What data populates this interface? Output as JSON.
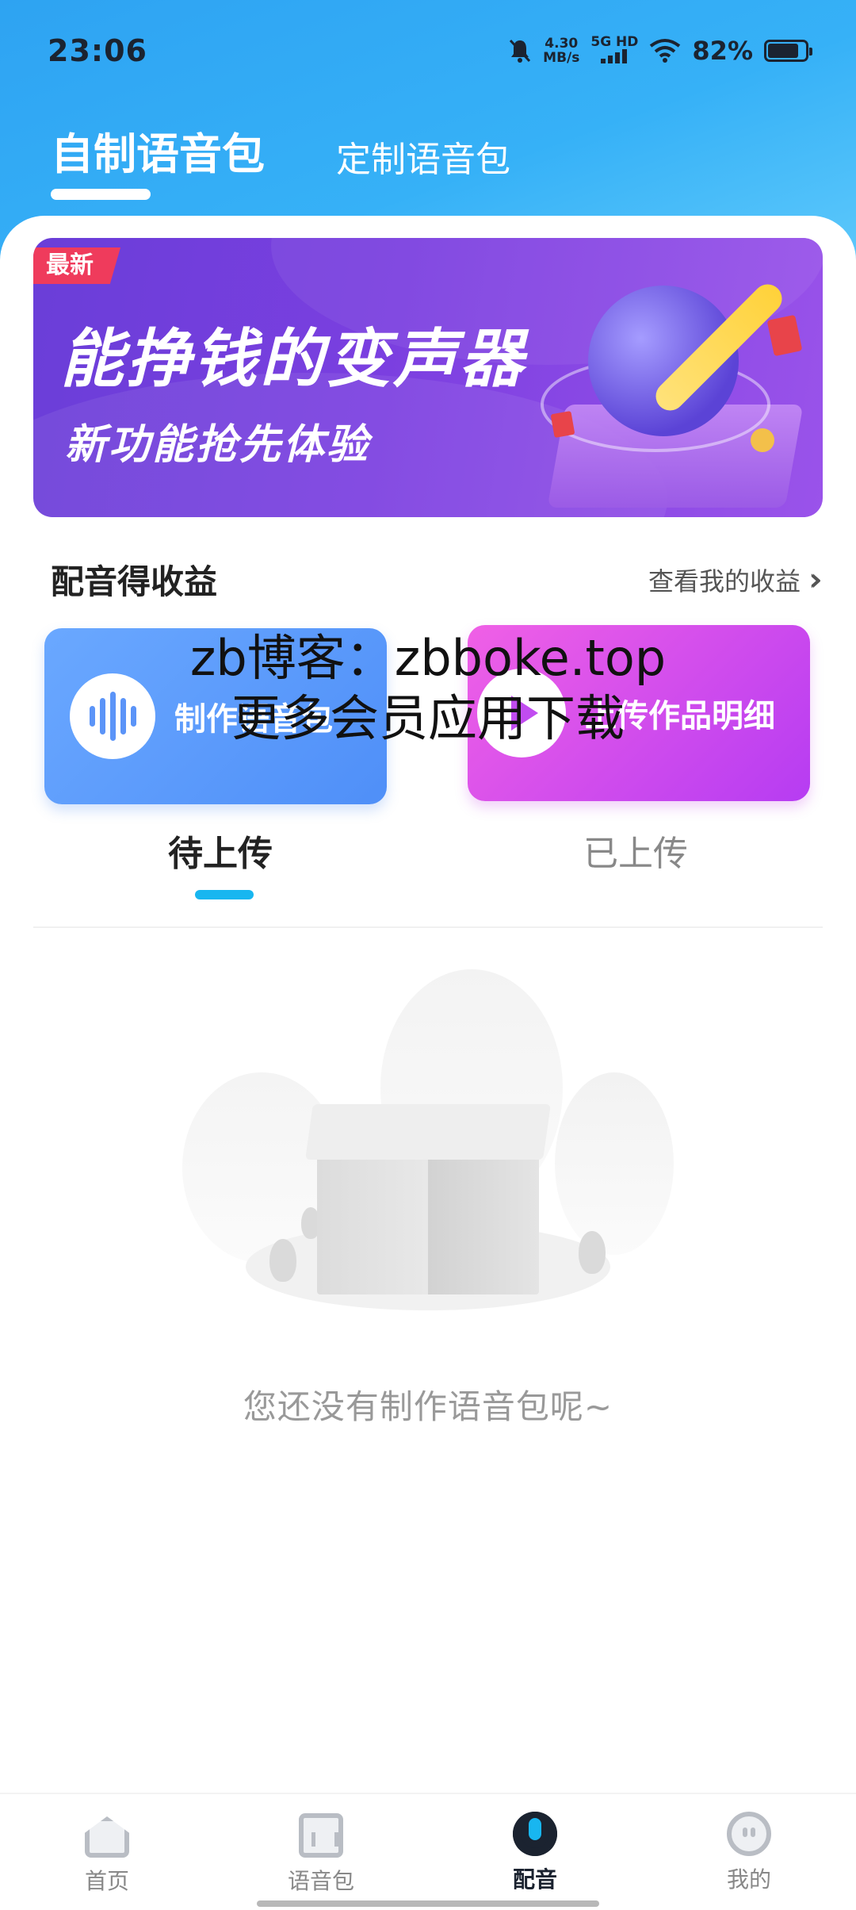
{
  "status": {
    "time": "23:06",
    "net_speed_value": "4.30",
    "net_speed_unit": "MB/s",
    "signal_label": "5G HD",
    "battery": "82%",
    "battery_level": 0.82
  },
  "top_tabs": [
    {
      "label": "自制语音包",
      "active": true
    },
    {
      "label": "定制语音包",
      "active": false
    }
  ],
  "banner": {
    "badge": "最新",
    "title": "能挣钱的变声器",
    "subtitle": "新功能抢先体验"
  },
  "section": {
    "title": "配音得收益",
    "link": "查看我的收益"
  },
  "feature_cards": [
    {
      "label": "制作语音包",
      "icon": "waveform-icon"
    },
    {
      "label": "上传作品明细",
      "icon": "play-icon"
    }
  ],
  "watermark": {
    "line1": "zb博客：zbboke.top",
    "line2": "更多会员应用下载"
  },
  "sub_tabs": [
    {
      "label": "待上传",
      "active": true
    },
    {
      "label": "已上传",
      "active": false
    }
  ],
  "empty_state": {
    "text": "您还没有制作语音包呢~"
  },
  "bottom_nav": [
    {
      "label": "首页",
      "icon": "home-icon",
      "active": false
    },
    {
      "label": "语音包",
      "icon": "voice-pack-icon",
      "active": false
    },
    {
      "label": "配音",
      "icon": "microphone-icon",
      "active": true
    },
    {
      "label": "我的",
      "icon": "profile-icon",
      "active": false
    }
  ],
  "colors": {
    "header_gradient": "#2ea3f2",
    "accent": "#18b6f0",
    "banner_purple": "#7b3fe0",
    "card_blue": "#4f8ff8",
    "card_pink": "#d84ef0"
  }
}
